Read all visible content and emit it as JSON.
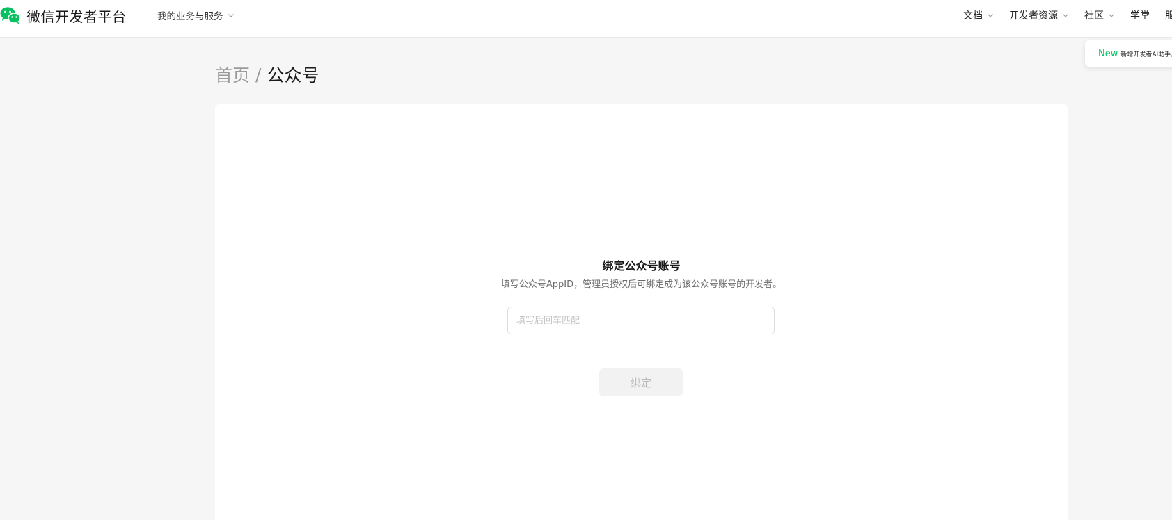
{
  "header": {
    "brand_title": "微信开发者平台",
    "biz_menu_label": "我的业务与服务",
    "nav": [
      {
        "label": "文档",
        "has_dropdown": true
      },
      {
        "label": "开发者资源",
        "has_dropdown": true
      },
      {
        "label": "社区",
        "has_dropdown": true
      },
      {
        "label": "学堂",
        "has_dropdown": false
      },
      {
        "label": "服",
        "has_dropdown": false
      }
    ]
  },
  "notice": {
    "badge": "New",
    "text": "新增开发者AI助手，"
  },
  "breadcrumb": {
    "home": "首页",
    "separator": "/",
    "current": "公众号"
  },
  "bind": {
    "title": "绑定公众号账号",
    "description": "填写公众号AppID，管理员授权后可绑定成为该公众号账号的开发者。",
    "input_placeholder": "填写后回车匹配",
    "input_value": "",
    "button_label": "绑定",
    "button_disabled": true
  },
  "colors": {
    "brand_green": "#07c160",
    "page_background": "#f6f6f6",
    "card_background": "#ffffff"
  }
}
